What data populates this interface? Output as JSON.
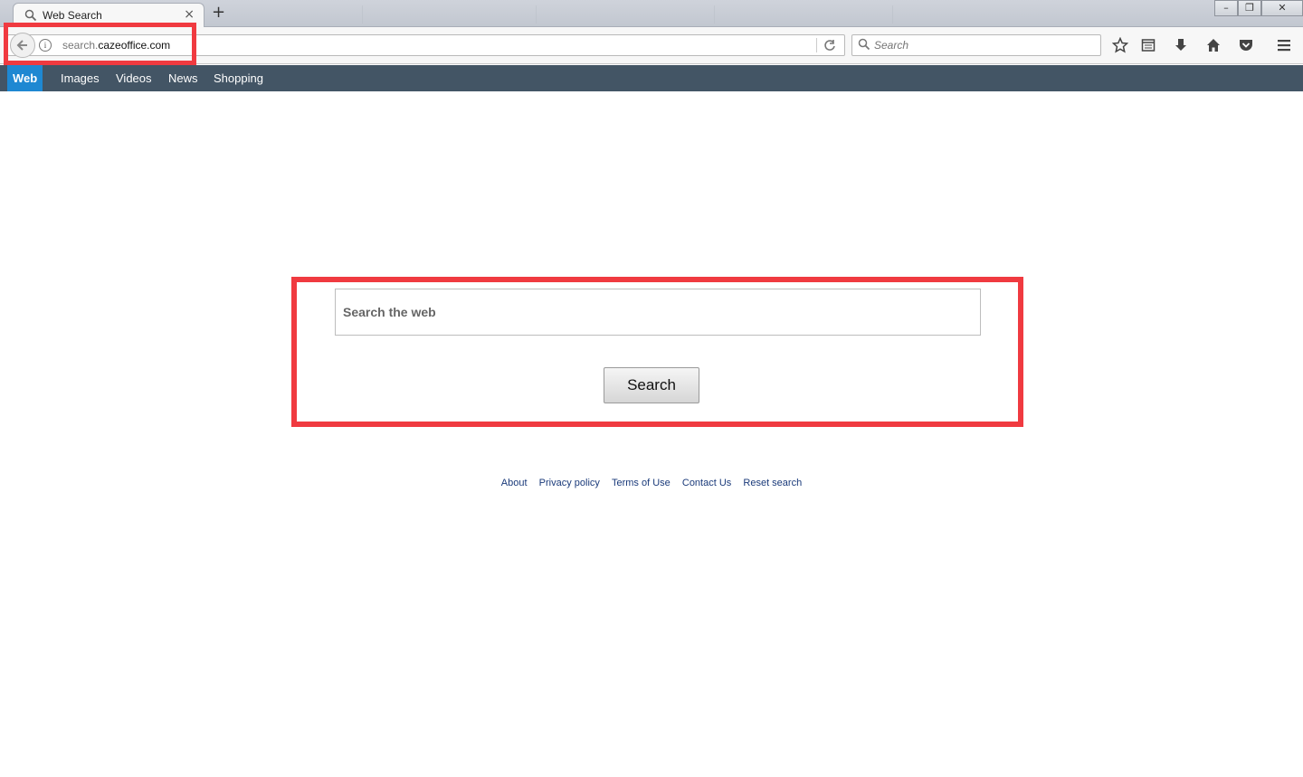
{
  "browser": {
    "tab_title": "Web Search",
    "tab_close": "×",
    "new_tab": "+",
    "window_controls": {
      "minimize": "–",
      "restore": "❐",
      "close": "✕"
    },
    "url": {
      "prefix": "search.",
      "host": "cazeoffice.com"
    },
    "search_placeholder": "Search",
    "toolbar_icons": [
      "star-icon",
      "reading-list-icon",
      "download-icon",
      "home-icon",
      "pocket-icon",
      "menu-icon"
    ]
  },
  "site_nav": {
    "items": [
      {
        "label": "Web",
        "active": true
      },
      {
        "label": "Images"
      },
      {
        "label": "Videos"
      },
      {
        "label": "News"
      },
      {
        "label": "Shopping"
      }
    ]
  },
  "search": {
    "placeholder": "Search the web",
    "button_label": "Search"
  },
  "footer": {
    "links": [
      "About",
      "Privacy policy",
      "Terms of Use",
      "Contact Us",
      "Reset search"
    ]
  },
  "colors": {
    "highlight": "#f03a40",
    "nav_bg": "#435565",
    "nav_active": "#1e88d2"
  }
}
